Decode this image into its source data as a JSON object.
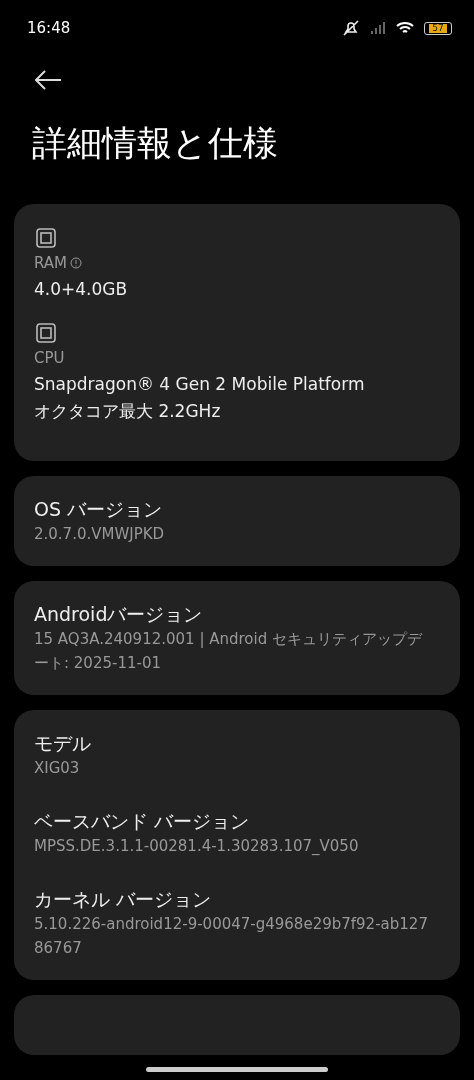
{
  "status_bar": {
    "time": "16:48",
    "battery_text": "57"
  },
  "header": {
    "title": "詳細情報と仕様"
  },
  "spec_card": {
    "items": [
      {
        "label": "RAM",
        "info": true,
        "value": "4.0+4.0GB"
      },
      {
        "label": "CPU",
        "info": false,
        "value": "Snapdragon® 4 Gen 2 Mobile Platform\nオクタコア最大 2.2GHz"
      }
    ]
  },
  "cards": [
    {
      "rows": [
        {
          "title": "OS バージョン",
          "value": "2.0.7.0.VMWJPKD"
        }
      ]
    },
    {
      "rows": [
        {
          "title": "Androidバージョン",
          "value": "15 AQ3A.240912.001 | Android セキュリティアップデート: 2025-11-01"
        }
      ]
    },
    {
      "rows": [
        {
          "title": "モデル",
          "value": "XIG03"
        },
        {
          "title": "ベースバンド バージョン",
          "value": "MPSS.DE.3.1.1-00281.4-1.30283.107_V050"
        },
        {
          "title": "カーネル バージョン",
          "value": "5.10.226-android12-9-00047-g4968e29b7f92-ab12786767"
        }
      ]
    }
  ]
}
